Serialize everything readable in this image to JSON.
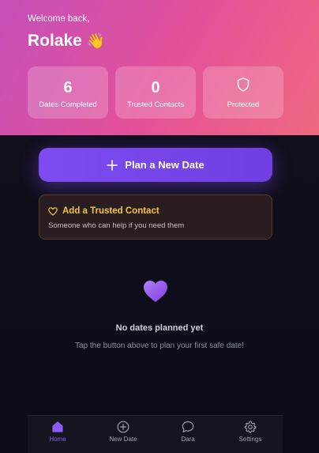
{
  "header": {
    "greeting": "Welcome back,",
    "user_name": "Rolake",
    "wave_emoji": "👋"
  },
  "stats": [
    {
      "value": "6",
      "label": "Dates Completed"
    },
    {
      "value": "0",
      "label": "Trusted Contacts"
    },
    {
      "icon": "shield-icon",
      "label": "Protected"
    }
  ],
  "primary_action": {
    "label": "Plan a New Date",
    "icon": "plus-icon"
  },
  "trusted_contact_card": {
    "title": "Add a Trusted Contact",
    "subtitle": "Someone who can help if you need them",
    "icon": "heart-outline-icon"
  },
  "empty_state": {
    "icon": "purple-heart-icon",
    "title": "No dates planned yet",
    "subtitle": "Tap the button above to plan your first safe date!"
  },
  "bottom_nav": {
    "active": "Home",
    "items": [
      {
        "label": "Home",
        "icon": "home-icon"
      },
      {
        "label": "New Date",
        "icon": "plus-circle-icon"
      },
      {
        "label": "Dara",
        "icon": "chat-bubble-icon"
      },
      {
        "label": "Settings",
        "icon": "gear-icon"
      }
    ]
  },
  "colors": {
    "hero_gradient_start": "#c550b8",
    "hero_gradient_end": "#f06880",
    "accent_purple": "#7c4cf0",
    "warning_gold": "#f5c542",
    "background": "#0f0d19"
  }
}
